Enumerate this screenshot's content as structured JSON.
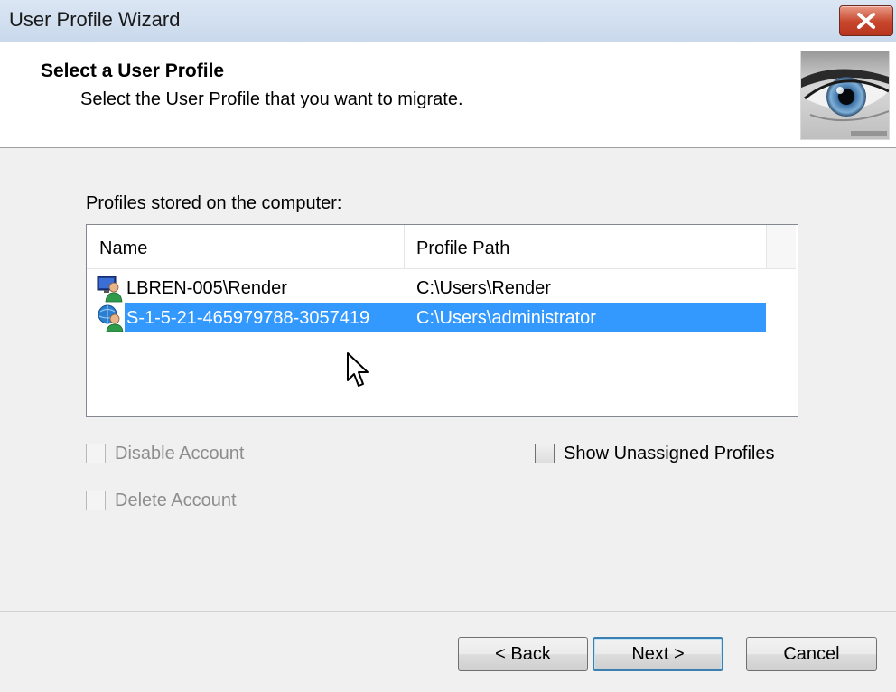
{
  "window": {
    "title": "User Profile Wizard",
    "close_icon": "close-icon"
  },
  "header": {
    "title": "Select a User Profile",
    "subtitle": "Select the User Profile that you want to migrate.",
    "image_icon": "eye-icon"
  },
  "profiles": {
    "label": "Profiles stored on the computer:",
    "columns": [
      "Name",
      "Profile Path"
    ],
    "rows": [
      {
        "name": "LBREN-005\\Render",
        "path": "C:\\Users\\Render",
        "icon": "local-user-icon",
        "selected": false
      },
      {
        "name": "S-1-5-21-465979788-3057419",
        "path": "C:\\Users\\administrator",
        "icon": "domain-user-icon",
        "selected": true
      }
    ]
  },
  "options": {
    "disable_account": {
      "label": "Disable Account",
      "checked": false,
      "enabled": false
    },
    "delete_account": {
      "label": "Delete Account",
      "checked": false,
      "enabled": false
    },
    "show_unassigned": {
      "label": "Show Unassigned Profiles",
      "checked": false,
      "enabled": true
    }
  },
  "buttons": {
    "back": "< Back",
    "next": "Next >",
    "cancel": "Cancel"
  },
  "colors": {
    "selection": "#3399ff",
    "titlebar": "#c9d9ec",
    "close_button": "#c7452b"
  }
}
